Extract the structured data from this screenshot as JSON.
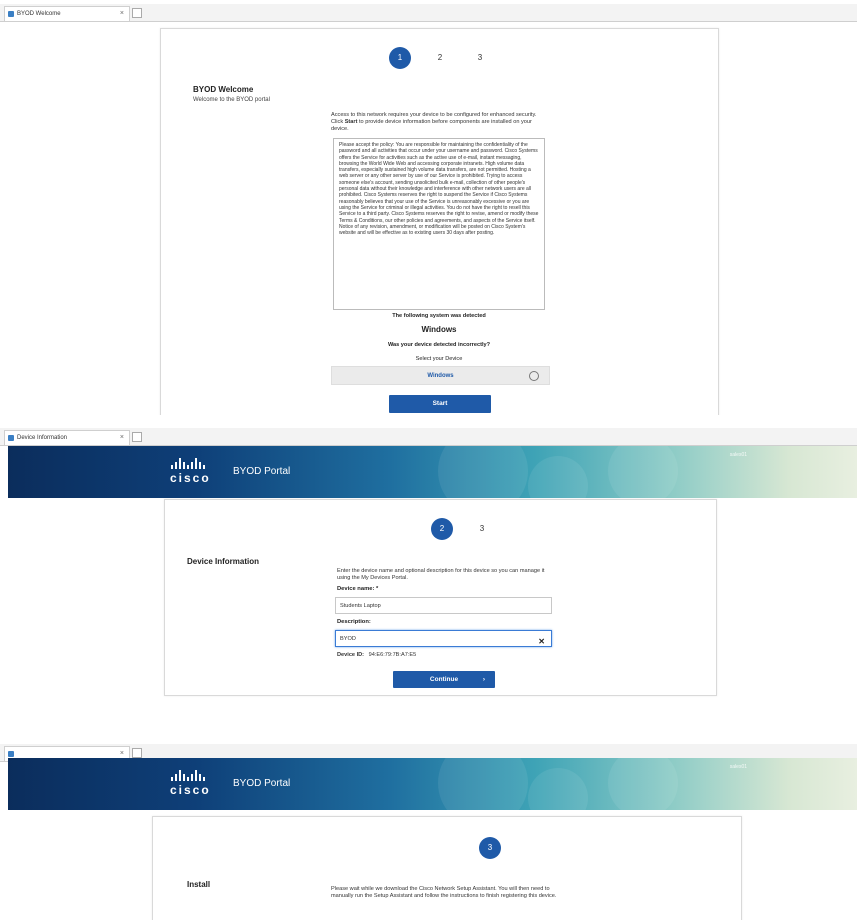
{
  "screen1": {
    "tab_title": "BYOD Welcome",
    "steps": [
      "1",
      "2",
      "3"
    ],
    "title": "BYOD Welcome",
    "subtitle": "Welcome to the BYOD portal",
    "intro_pre": "Access to this network requires your device to be configured for enhanced security. Click ",
    "intro_bold": "Start",
    "intro_post": " to provide device information before components are installed on your device.",
    "policy": "Please accept the policy: You are responsible for maintaining the confidentiality of the password and all activities that occur under your username and password. Cisco Systems offers the Service for activities such as the active use of e-mail, instant messaging, browsing the World Wide Web and accessing corporate intranets. High volume data transfers, especially sustained high volume data transfers, are not permitted. Hosting a web server or any other server by use of our Service is prohibited. Trying to access someone else's account, sending unsolicited bulk e-mail, collection of other people's personal data without their knowledge and interference with other network users are all prohibited. Cisco Systems reserves the right to suspend the Service if Cisco Systems reasonably believes that your use of the Service is unreasonably excessive or you are using the Service for criminal or illegal activities. You do not have the right to resell this Service to a third party. Cisco Systems reserves the right to revise, amend or modify these Terms & Conditions, our other policies and agreements, and aspects of the Service itself. Notice of any revision, amendment, or modification will be posted on Cisco System's website and will be effective as to existing users 30 days after posting.",
    "detected_label": "The following system was detected",
    "detected_os": "Windows",
    "wrong_prompt": "Was your device detected incorrectly?",
    "select_label": "Select your Device",
    "select_value": "Windows",
    "start_button": "Start"
  },
  "screen2": {
    "tab_title": "Device Information",
    "brand": "cisco",
    "portal_title": "BYOD Portal",
    "user": "sales01",
    "steps": [
      "2",
      "3"
    ],
    "title": "Device Information",
    "intro": "Enter the device name and optional description for this device so you can manage it using the My Devices Portal.",
    "device_name_label": "Device name: *",
    "device_name_value": "Students Laptop",
    "description_label": "Description:",
    "description_value": "BYOD",
    "device_id_label": "Device ID:",
    "device_id_value": "94:E6:79:7B:A7:E5",
    "continue_button": "Continue"
  },
  "screen3": {
    "tab_title": "",
    "brand": "cisco",
    "portal_title": "BYOD Portal",
    "user": "sales01",
    "steps": [
      "3"
    ],
    "title": "Install",
    "intro": "Please wait while we download the Cisco Network Setup Assistant. You will then need to manually run the Setup Assistant and follow the instructions to finish registering this device."
  },
  "colors": {
    "accent": "#1f5aa8",
    "banner_dark": "#0b2d5c",
    "banner_light": "#d7e7d3"
  },
  "icons": {
    "favicon": "tab-favicon",
    "close": "close-icon",
    "clear": "clear-input-icon",
    "chevron": "chevron-right-icon",
    "dropdown": "dropdown-circle-icon"
  }
}
